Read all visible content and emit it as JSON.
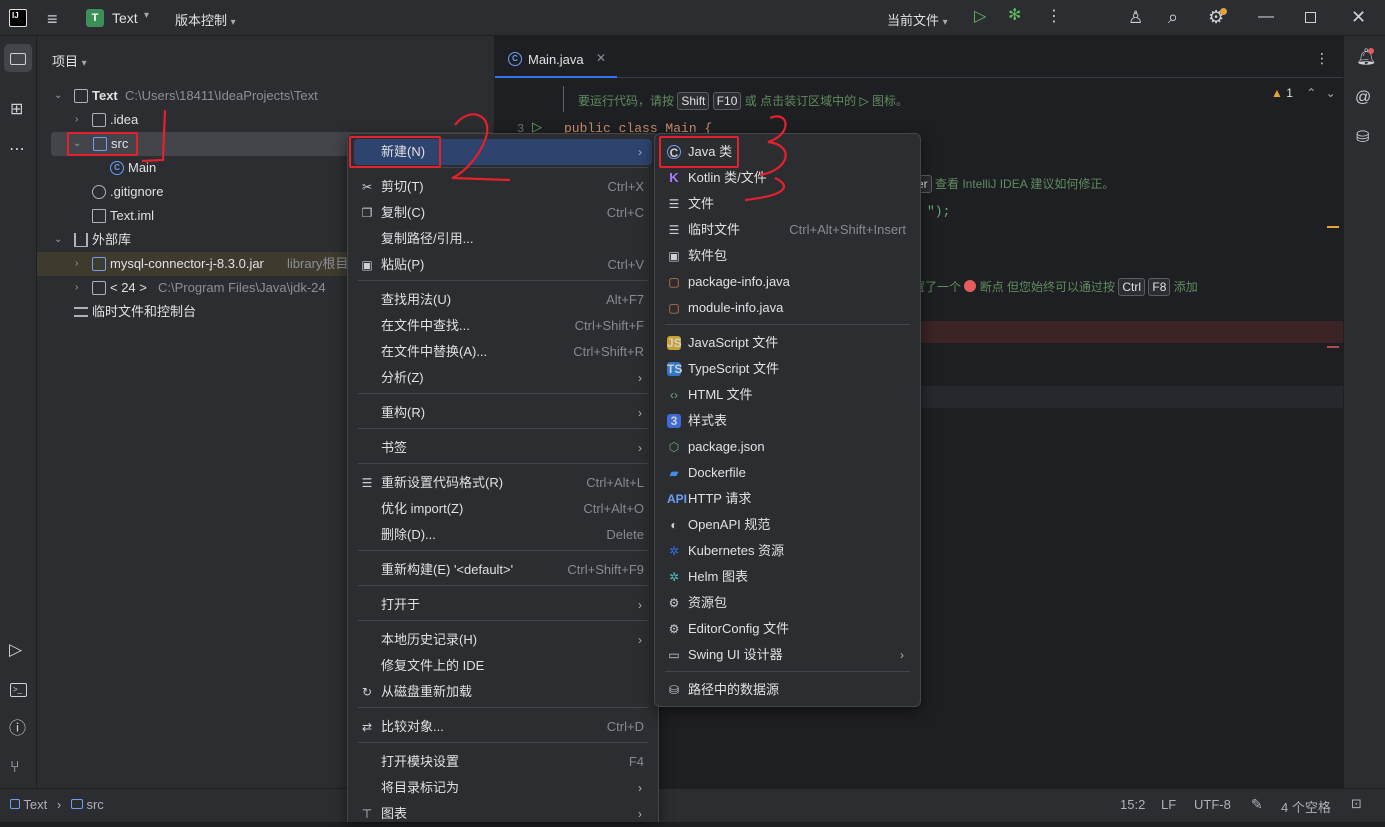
{
  "title_bar": {
    "app_badge": "T",
    "project": "Text",
    "vcs": "版本控制",
    "run_config": "当前文件"
  },
  "project_panel": {
    "title": "项目",
    "tree": [
      {
        "label": "Text",
        "sub": "C:\\Users\\18411\\IdeaProjects\\Text"
      },
      {
        "label": ".idea",
        "sub": ""
      },
      {
        "label": "src",
        "sub": ""
      },
      {
        "label": "Main",
        "sub": ""
      },
      {
        "label": ".gitignore",
        "sub": ""
      },
      {
        "label": "Text.iml",
        "sub": ""
      },
      {
        "label": "外部库",
        "sub": ""
      },
      {
        "label": "mysql-connector-j-8.3.0.jar",
        "sub": "library根目"
      },
      {
        "label": "< 24 >",
        "sub": "C:\\Program Files\\Java\\jdk-24"
      },
      {
        "label": "临时文件和控制台",
        "sub": ""
      }
    ]
  },
  "editor": {
    "tab": "Main.java",
    "hint_line": {
      "pre": "要运行代码，请按",
      "k1": "Shift",
      "k2": "F10",
      "mid": "或 点击装订区域中的",
      "post": "图标。"
    },
    "code_line3": "public class Main {",
    "line_no": "3",
    "warn_count": "1",
    "hint2": {
      "k": "er",
      "post": "查看 IntelliJ IDEA 建议如何修正。"
    },
    "code_frag": "\");",
    "hint3": {
      "pre": "置了一个",
      "mid": "断点 但您始终可以通过按",
      "k1": "Ctrl",
      "k2": "F8",
      "post": "添加"
    }
  },
  "context_menu": {
    "items": [
      {
        "label": "新建(N)",
        "shortcut": "",
        "submenu": true,
        "icon": ""
      },
      {
        "label": "剪切(T)",
        "shortcut": "Ctrl+X",
        "submenu": false,
        "icon": "scissors-icon"
      },
      {
        "label": "复制(C)",
        "shortcut": "Ctrl+C",
        "submenu": false,
        "icon": "copy-icon"
      },
      {
        "label": "复制路径/引用...",
        "shortcut": "",
        "submenu": false,
        "icon": ""
      },
      {
        "label": "粘贴(P)",
        "shortcut": "Ctrl+V",
        "submenu": false,
        "icon": "paste-icon"
      },
      {
        "label": "查找用法(U)",
        "shortcut": "Alt+F7",
        "submenu": false,
        "icon": ""
      },
      {
        "label": "在文件中查找...",
        "shortcut": "Ctrl+Shift+F",
        "submenu": false,
        "icon": ""
      },
      {
        "label": "在文件中替换(A)...",
        "shortcut": "Ctrl+Shift+R",
        "submenu": false,
        "icon": ""
      },
      {
        "label": "分析(Z)",
        "shortcut": "",
        "submenu": true,
        "icon": ""
      },
      {
        "label": "重构(R)",
        "shortcut": "",
        "submenu": true,
        "icon": ""
      },
      {
        "label": "书签",
        "shortcut": "",
        "submenu": true,
        "icon": ""
      },
      {
        "label": "重新设置代码格式(R)",
        "shortcut": "Ctrl+Alt+L",
        "submenu": false,
        "icon": "format-icon"
      },
      {
        "label": "优化 import(Z)",
        "shortcut": "Ctrl+Alt+O",
        "submenu": false,
        "icon": ""
      },
      {
        "label": "删除(D)...",
        "shortcut": "Delete",
        "submenu": false,
        "icon": ""
      },
      {
        "label": "重新构建(E) '<default>'",
        "shortcut": "Ctrl+Shift+F9",
        "submenu": false,
        "icon": ""
      },
      {
        "label": "打开于",
        "shortcut": "",
        "submenu": true,
        "icon": ""
      },
      {
        "label": "本地历史记录(H)",
        "shortcut": "",
        "submenu": true,
        "icon": ""
      },
      {
        "label": "修复文件上的 IDE",
        "shortcut": "",
        "submenu": false,
        "icon": ""
      },
      {
        "label": "从磁盘重新加载",
        "shortcut": "",
        "submenu": false,
        "icon": "reload-icon"
      },
      {
        "label": "比较对象...",
        "shortcut": "Ctrl+D",
        "submenu": false,
        "icon": "compare-icon"
      },
      {
        "label": "打开模块设置",
        "shortcut": "F4",
        "submenu": false,
        "icon": ""
      },
      {
        "label": "将目录标记为",
        "shortcut": "",
        "submenu": true,
        "icon": ""
      },
      {
        "label": "图表",
        "shortcut": "",
        "submenu": true,
        "icon": "diagram-icon"
      }
    ]
  },
  "new_submenu": {
    "items": [
      {
        "label": "Java 类",
        "shortcut": ""
      },
      {
        "label": "Kotlin 类/文件",
        "shortcut": ""
      },
      {
        "label": "文件",
        "shortcut": ""
      },
      {
        "label": "临时文件",
        "shortcut": "Ctrl+Alt+Shift+Insert"
      },
      {
        "label": "软件包",
        "shortcut": ""
      },
      {
        "label": "package-info.java",
        "shortcut": ""
      },
      {
        "label": "module-info.java",
        "shortcut": ""
      },
      {
        "label": "JavaScript 文件",
        "shortcut": ""
      },
      {
        "label": "TypeScript 文件",
        "shortcut": ""
      },
      {
        "label": "HTML 文件",
        "shortcut": ""
      },
      {
        "label": "样式表",
        "shortcut": ""
      },
      {
        "label": "package.json",
        "shortcut": ""
      },
      {
        "label": "Dockerfile",
        "shortcut": ""
      },
      {
        "label": "HTTP 请求",
        "shortcut": ""
      },
      {
        "label": "OpenAPI 规范",
        "shortcut": ""
      },
      {
        "label": "Kubernetes 资源",
        "shortcut": ""
      },
      {
        "label": "Helm 图表",
        "shortcut": ""
      },
      {
        "label": "资源包",
        "shortcut": ""
      },
      {
        "label": "EditorConfig 文件",
        "shortcut": ""
      },
      {
        "label": "Swing UI 设计器",
        "shortcut": ""
      },
      {
        "label": "路径中的数据源",
        "shortcut": ""
      }
    ],
    "badges": {
      "js": "JS",
      "ts": "TS",
      "css": "3",
      "api": "API",
      "c": "C",
      "k": "K"
    }
  },
  "status_bar": {
    "crumb1": "Text",
    "crumb2": "src",
    "position": "15:2",
    "line_sep": "LF",
    "encoding": "UTF-8",
    "indent": "4 个空格"
  },
  "annotations": {
    "two": "2",
    "three": "3"
  },
  "colors": {
    "accent": "#2e436e",
    "annotation": "#e4212d",
    "run": "#5fb85f"
  }
}
